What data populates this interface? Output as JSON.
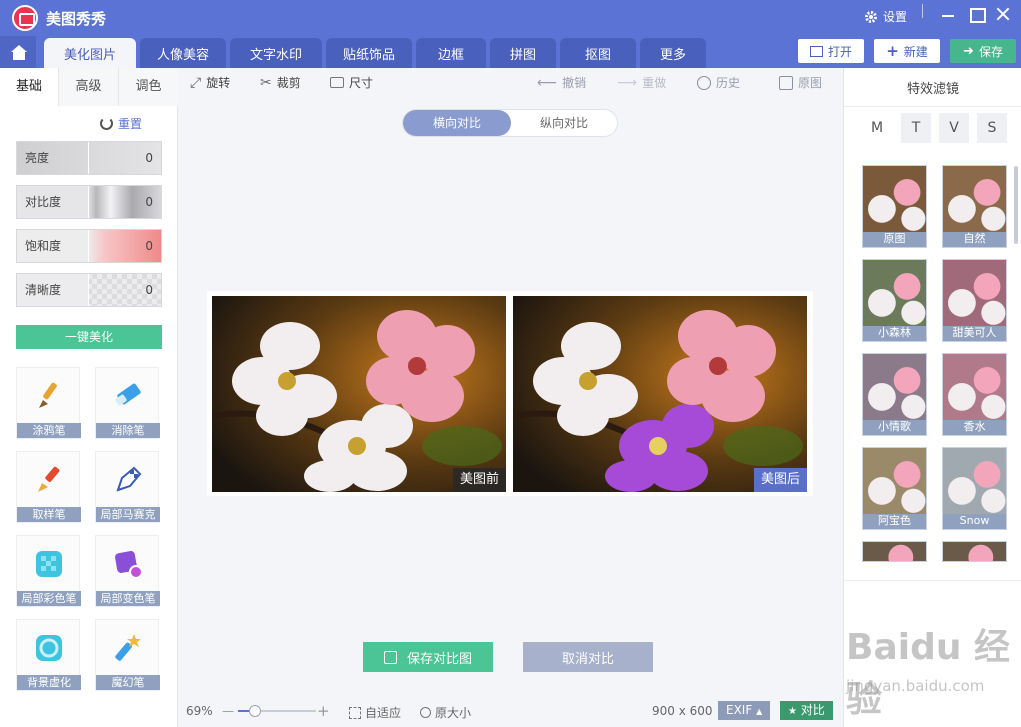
{
  "app": {
    "title": "美图秀秀",
    "settings_label": "设置"
  },
  "tabs": [
    "美化图片",
    "人像美容",
    "文字水印",
    "贴纸饰品",
    "边框",
    "拼图",
    "抠图",
    "更多"
  ],
  "top_buttons": {
    "open": "打开",
    "new": "新建",
    "save": "保存"
  },
  "left_panel": {
    "tabs": [
      "基础",
      "高级",
      "调色"
    ],
    "reset_label": "重置",
    "sliders": [
      {
        "label": "亮度",
        "value": "0"
      },
      {
        "label": "对比度",
        "value": "0"
      },
      {
        "label": "饱和度",
        "value": "0"
      },
      {
        "label": "清晰度",
        "value": "0"
      }
    ],
    "onekey_label": "一键美化",
    "tools": [
      {
        "label": "涂鸦笔",
        "icon": "brush-icon"
      },
      {
        "label": "消除笔",
        "icon": "eraser-icon"
      },
      {
        "label": "取样笔",
        "icon": "sample-brush-icon"
      },
      {
        "label": "局部马赛克",
        "icon": "mosaic-pen-icon"
      },
      {
        "label": "局部彩色笔",
        "icon": "color-cube-icon"
      },
      {
        "label": "局部变色笔",
        "icon": "color-change-icon"
      },
      {
        "label": "背景虚化",
        "icon": "blur-icon"
      },
      {
        "label": "魔幻笔",
        "icon": "magic-pen-icon"
      }
    ]
  },
  "edit_toolbar": {
    "rotate": "旋转",
    "crop": "裁剪",
    "size": "尺寸",
    "undo": "撤销",
    "redo": "重做",
    "history": "历史",
    "original": "原图"
  },
  "compare": {
    "horizontal": "横向对比",
    "vertical": "纵向对比",
    "before_label": "美图前",
    "after_label": "美图后",
    "save_button": "保存对比图",
    "cancel_button": "取消对比"
  },
  "status": {
    "zoom": "69%",
    "zoom_level": 0.22,
    "fit": "自适应",
    "actual_size": "原大小",
    "dimensions": "900 x 600",
    "exif": "EXIF",
    "compare": "对比"
  },
  "right_panel": {
    "title": "特效滤镜",
    "categories": [
      "M",
      "T",
      "V",
      "S"
    ],
    "filters": [
      "原图",
      "自然",
      "小森林",
      "甜美可人",
      "小情歌",
      "香水",
      "阿宝色",
      "Snow"
    ]
  },
  "watermark": {
    "brand": "Baidu 经验",
    "url": "jingyan.baidu.com"
  },
  "colors": {
    "brand": "#5b73d4",
    "accent_green": "#4bc595",
    "tag_dark": "#3a3a3a",
    "tag_blue": "#5b73d4"
  }
}
